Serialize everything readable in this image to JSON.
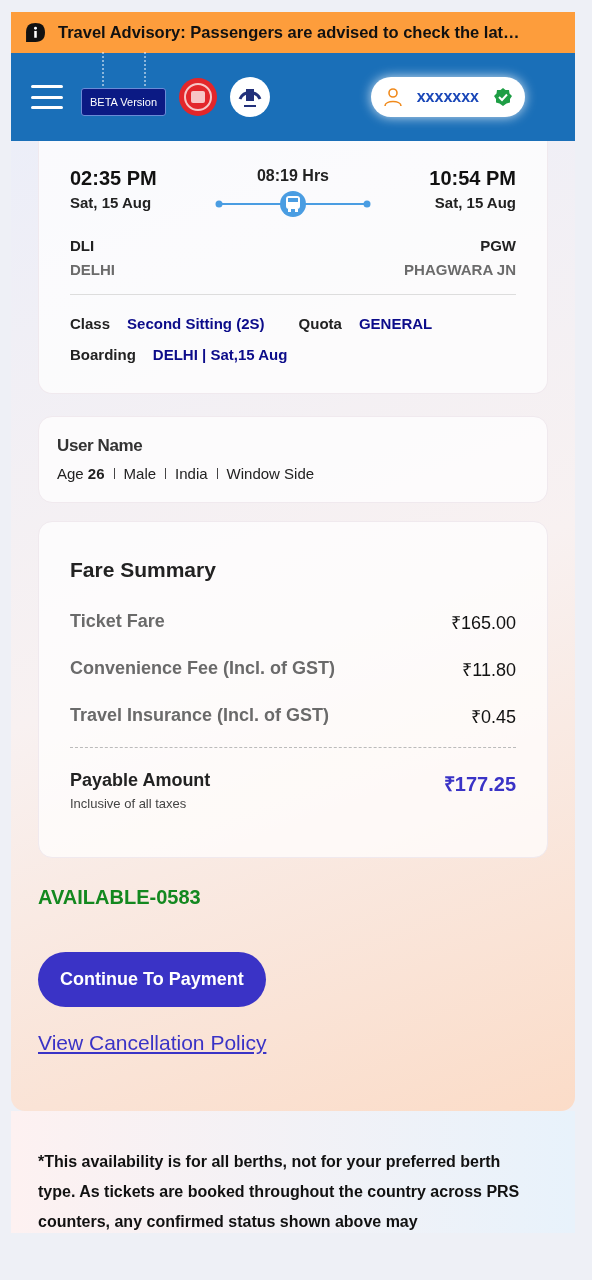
{
  "advisory": {
    "text": "Travel Advisory: Passengers are advised to check the lat…"
  },
  "header": {
    "beta_label": "BETA Version",
    "user": {
      "name": "xxxxxxx",
      "verified": true
    }
  },
  "journey": {
    "departure": {
      "time": "02:35 PM",
      "date": "Sat, 15 Aug",
      "code": "DLI",
      "station": "DELHI"
    },
    "duration": "08:19 Hrs",
    "arrival": {
      "time": "10:54 PM",
      "date": "Sat, 15 Aug",
      "code": "PGW",
      "station": "PHAGWARA JN"
    },
    "details": [
      {
        "label": "Class",
        "value": "Second Sitting (2S)"
      },
      {
        "label": "Quota",
        "value": "GENERAL"
      },
      {
        "label": "Boarding",
        "value": "DELHI | Sat,15 Aug"
      }
    ]
  },
  "passenger": {
    "name": "User Name",
    "details": [
      "Age **26**",
      "Male",
      "India",
      "Window Side"
    ]
  },
  "fare_summary": {
    "title": "Fare Summary",
    "items": [
      {
        "label": "Ticket Fare",
        "amount": "₹165.00"
      },
      {
        "label": "Convenience Fee (Incl. of GST)",
        "amount": "₹11.80"
      },
      {
        "label": "Travel Insurance (Incl. of GST)",
        "amount": "₹0.45"
      }
    ],
    "total": {
      "label": "Payable Amount",
      "note": "Inclusive of all taxes",
      "amount": "₹177.25"
    }
  },
  "availability": "AVAILABLE-0583",
  "continue_button": "Continue To Payment",
  "cancellation_link": "View Cancellation Policy",
  "disclaimer": "*This availability is for all berths, not for your preferred berth type. As tickets are booked throughout the country across PRS counters, any confirmed status shown above may"
}
